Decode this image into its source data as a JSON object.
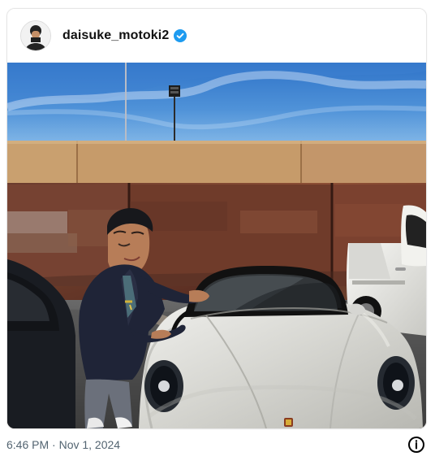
{
  "post": {
    "username": "daisuke_motoki2",
    "verified": true,
    "timestamp": "6:46 PM · Nov 1, 2024"
  },
  "icons": {
    "avatar": "profile-avatar",
    "verified": "verified-badge-icon",
    "info": "info-icon"
  },
  "colors": {
    "verified_blue": "#1d9bf0",
    "timestamp_gray": "#536471"
  }
}
